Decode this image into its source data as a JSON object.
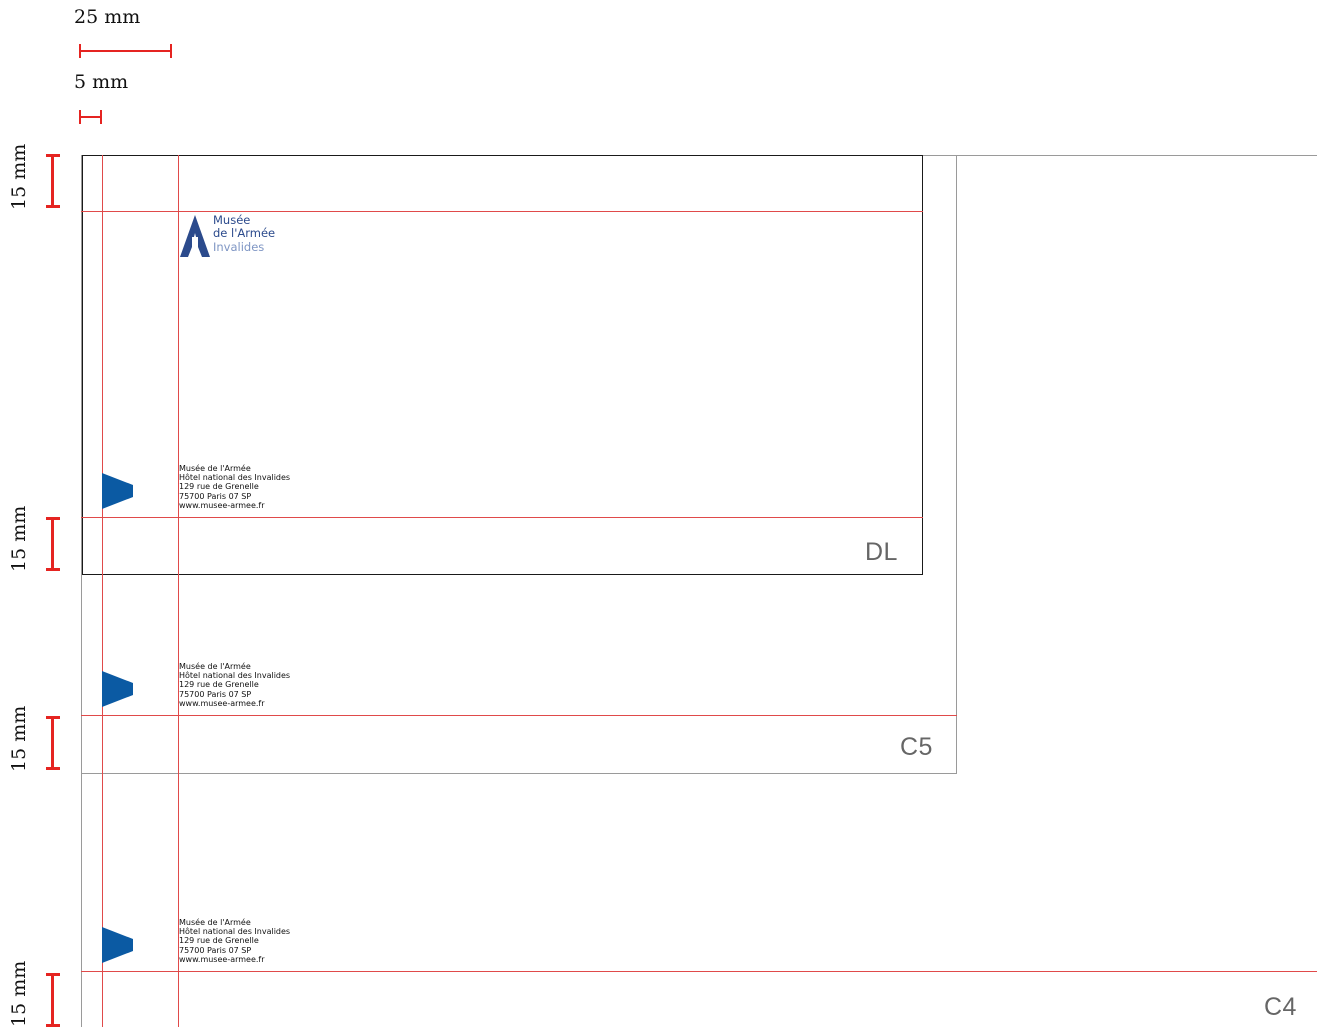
{
  "scale": {
    "label_25mm": "25 mm",
    "label_5mm": "5 mm",
    "margin_label": "15 mm"
  },
  "logo": {
    "line1": "Musée",
    "line2": "de l'Armée",
    "line3": "Invalides",
    "color_primary": "#2b4a8c",
    "color_secondary": "#7f96c4"
  },
  "address": {
    "line1": "Musée de l'Armée",
    "line2": "Hôtel national des Invalides",
    "line3": "129 rue de Grenelle",
    "line4": "75700 Paris 07 SP",
    "line5": "www.musee-armee.fr"
  },
  "envelopes": {
    "dl": "DL",
    "c5": "C5",
    "c4": "C4"
  },
  "colors": {
    "guide_red": "#e52421",
    "marker_blue": "#0b5aa3"
  }
}
